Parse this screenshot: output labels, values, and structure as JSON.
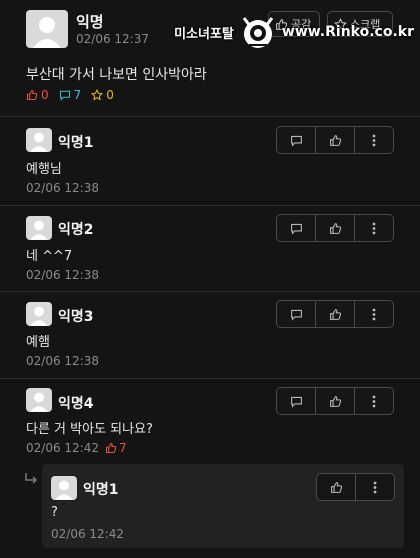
{
  "post": {
    "author": "익명",
    "date": "02/06 12:37",
    "body": "부산대 가서 나보면 인사박아라",
    "likes": "0",
    "comments": "7",
    "scraps": "0",
    "like_button_label": "공감",
    "scrap_button_label": "스크랩"
  },
  "watermark": {
    "text": "미소녀포탈",
    "url": "www.Rinko.co.kr"
  },
  "comments": [
    {
      "author": "익명1",
      "body": "예행님",
      "date": "02/06 12:38"
    },
    {
      "author": "익명2",
      "body": "네 ^^7",
      "date": "02/06 12:38"
    },
    {
      "author": "익명3",
      "body": "예햄",
      "date": "02/06 12:38"
    },
    {
      "author": "익명4",
      "body": "다른 거 박아도 되나요?",
      "date": "02/06 12:42",
      "likes": "7"
    }
  ],
  "reply": {
    "author": "익명1",
    "body": "?",
    "date": "02/06 12:42"
  },
  "colors": {
    "background": "#141414",
    "like_red": "#e5533d",
    "comment_teal": "#3fc1c9",
    "scrap_yellow": "#e6b422",
    "reply_bg": "#222222"
  }
}
